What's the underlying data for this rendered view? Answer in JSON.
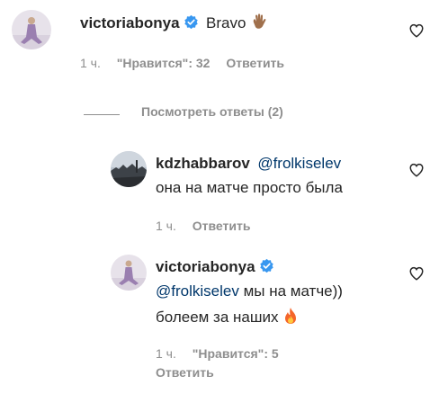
{
  "comments": [
    {
      "username": "victoriabonya",
      "verified": true,
      "text": "Bravo",
      "emoji_icon": "waving-hand-emoji-icon",
      "time": "1 ч.",
      "likes_label": "\"Нравится\": 32",
      "reply_label": "Ответить"
    }
  ],
  "view_replies_label": "Посмотреть ответы (2)",
  "replies": [
    {
      "username": "kdzhabbarov",
      "mention": "@frolkiselev",
      "text": "она на матче просто была",
      "time": "1 ч.",
      "reply_label": "Ответить"
    },
    {
      "username": "victoriabonya",
      "verified": true,
      "mention": "@frolkiselev",
      "text_line1": "мы на матче))",
      "text_line2": "болеем за наших",
      "emoji_icon": "fire-emoji-icon",
      "time": "1 ч.",
      "likes_label": "\"Нравится\": 5",
      "reply_label": "Ответить"
    }
  ],
  "colors": {
    "primary_text": "#262626",
    "secondary_text": "#8e8e8e",
    "mention": "#00376b",
    "verified_badge": "#3897f0"
  }
}
